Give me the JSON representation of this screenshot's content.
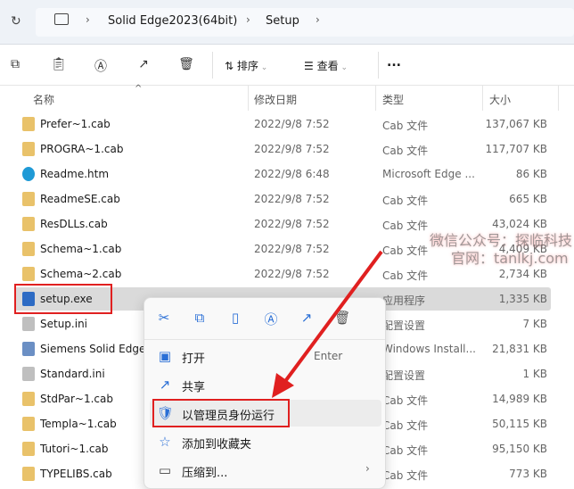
{
  "breadcrumb": [
    "Solid Edge2023(64bit)",
    "Setup"
  ],
  "toolbar": {
    "sort": "排序",
    "view": "查看",
    "more": "..."
  },
  "columns": {
    "name": "名称",
    "date": "修改日期",
    "type": "类型",
    "size": "大小"
  },
  "files": [
    {
      "name": "Prefer~1.cab",
      "date": "2022/9/8 7:52",
      "type": "Cab 文件",
      "size": "137,067 KB",
      "icon": "cab"
    },
    {
      "name": "PROGRA~1.cab",
      "date": "2022/9/8 7:52",
      "type": "Cab 文件",
      "size": "117,707 KB",
      "icon": "cab"
    },
    {
      "name": "Readme.htm",
      "date": "2022/9/8 6:48",
      "type": "Microsoft Edge ...",
      "size": "86 KB",
      "icon": "edge"
    },
    {
      "name": "ReadmeSE.cab",
      "date": "2022/9/8 7:52",
      "type": "Cab 文件",
      "size": "665 KB",
      "icon": "cab"
    },
    {
      "name": "ResDLLs.cab",
      "date": "2022/9/8 7:52",
      "type": "Cab 文件",
      "size": "43,024 KB",
      "icon": "cab"
    },
    {
      "name": "Schema~1.cab",
      "date": "2022/9/8 7:52",
      "type": "Cab 文件",
      "size": "4,409 KB",
      "icon": "cab"
    },
    {
      "name": "Schema~2.cab",
      "date": "2022/9/8 7:52",
      "type": "Cab 文件",
      "size": "2,734 KB",
      "icon": "cab"
    },
    {
      "name": "setup.exe",
      "date": "",
      "type": "应用程序",
      "size": "1,335 KB",
      "icon": "exe"
    },
    {
      "name": "Setup.ini",
      "date": "",
      "type": "配置设置",
      "size": "7 KB",
      "icon": "ini"
    },
    {
      "name": "Siemens Solid Edge",
      "date": "",
      "type": "Windows Install...",
      "size": "21,831 KB",
      "icon": "msi"
    },
    {
      "name": "Standard.ini",
      "date": "",
      "type": "配置设置",
      "size": "1 KB",
      "icon": "ini"
    },
    {
      "name": "StdPar~1.cab",
      "date": "",
      "type": "Cab 文件",
      "size": "14,989 KB",
      "icon": "cab"
    },
    {
      "name": "Templa~1.cab",
      "date": "",
      "type": "Cab 文件",
      "size": "50,115 KB",
      "icon": "cab"
    },
    {
      "name": "Tutori~1.cab",
      "date": "",
      "type": "Cab 文件",
      "size": "95,150 KB",
      "icon": "cab"
    },
    {
      "name": "TYPELIBS.cab",
      "date": "",
      "type": "Cab 文件",
      "size": "773 KB",
      "icon": "cab"
    }
  ],
  "menu": {
    "items": [
      {
        "label": "打开",
        "shortcut": "Enter"
      },
      {
        "label": "共享"
      },
      {
        "label": "以管理员身份运行"
      },
      {
        "label": "添加到收藏夹"
      },
      {
        "label": "压缩到..."
      }
    ]
  },
  "watermark": {
    "line1": "微信公众号：探临科技",
    "line2": "官网：tanlkj.com"
  },
  "colors": {
    "highlight": "#e02020",
    "accent": "#2a6fd6"
  }
}
